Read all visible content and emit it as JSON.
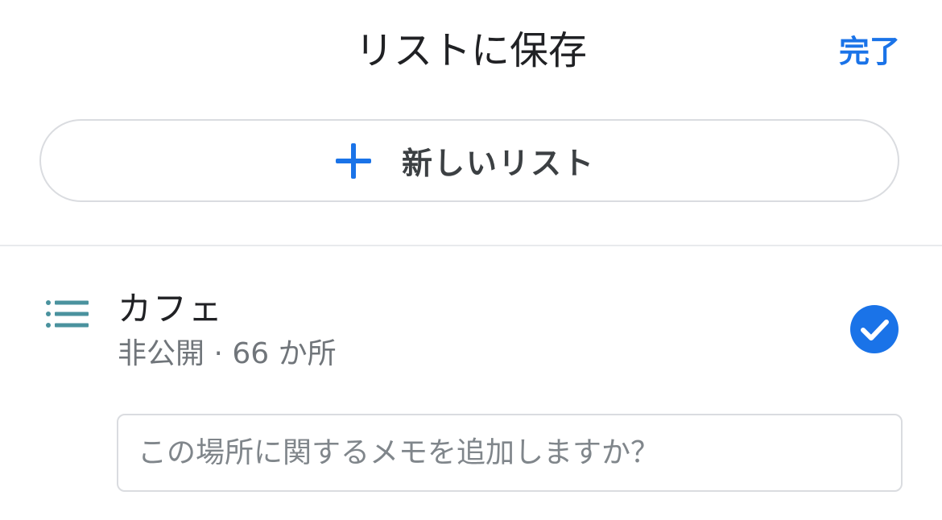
{
  "header": {
    "title": "リストに保存",
    "done_label": "完了"
  },
  "new_list": {
    "label": "新しいリスト",
    "icon": "plus-icon"
  },
  "lists": [
    {
      "name": "カフェ",
      "meta": "非公開 · 66 か所",
      "icon": "list-icon",
      "checked": true
    }
  ],
  "note": {
    "placeholder": "この場所に関するメモを追加しますか？",
    "value": ""
  },
  "colors": {
    "accent": "#1a73e8",
    "list_icon": "#4a929e",
    "border": "#dadce0",
    "secondary_text": "#70757a"
  }
}
